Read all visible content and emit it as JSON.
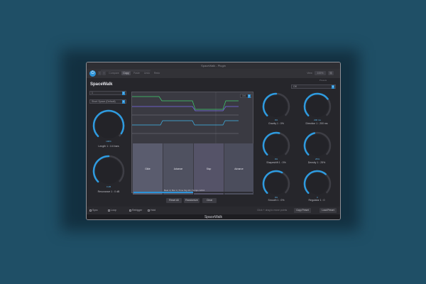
{
  "window": {
    "title": "SpaceWalk - Plugin"
  },
  "toolbar": {
    "tabs": [
      "Compare",
      "Copy",
      "Paste",
      "Undo",
      "Redo"
    ],
    "active_tab": 1,
    "view_label": "View",
    "zoom_value": "100%",
    "preset_label": "Presets"
  },
  "plugin": {
    "brand": "SpaceWalk",
    "footer": "SpaceWalk",
    "dropdown_left_1": "1",
    "dropdown_left_2": "Short Space (Default)",
    "dropdown_right": "Off",
    "dropdown_display": "1/4"
  },
  "knobs_left": [
    {
      "label": "Length 1 : 1/4 bars",
      "value": "100%",
      "level": 0.95
    },
    {
      "label": "Resonance 1 : 0 dB",
      "value": "0 dB",
      "level": 0.5
    }
  ],
  "knobs_right": [
    {
      "label": "Gravity 1 : 0%",
      "value": "0%",
      "level": 0.5
    },
    {
      "label": "Direction 1 : 200 ms",
      "value": "200 ms",
      "level": 0.7
    },
    {
      "label": "Shapeshift 1 : 0%",
      "value": "0%",
      "level": 0.55
    },
    {
      "label": "Density 1 : 25%",
      "value": "25%",
      "level": 0.45
    },
    {
      "label": "Smooth 1 : 0%",
      "value": "0%",
      "level": 0.6
    },
    {
      "label": "Regulator 1 : 0",
      "value": "0",
      "level": 0.65
    }
  ],
  "pads": [
    "Glide",
    "Advance",
    "Stop",
    "Advance"
  ],
  "display": {
    "readout": "Beat 4 | Bar 1 | Time Sig 4/4 | Tempo 120.0",
    "progress": 0.5
  },
  "pad_buttons": [
    "Reset All",
    "Randomize",
    "Clear"
  ],
  "bottom": {
    "checks": [
      "Sync",
      "Loop",
      "Retrigger",
      "Hold"
    ],
    "center_text": "Click + drag to move points",
    "buttons": [
      "Copy Preset",
      "Load Preset"
    ]
  }
}
